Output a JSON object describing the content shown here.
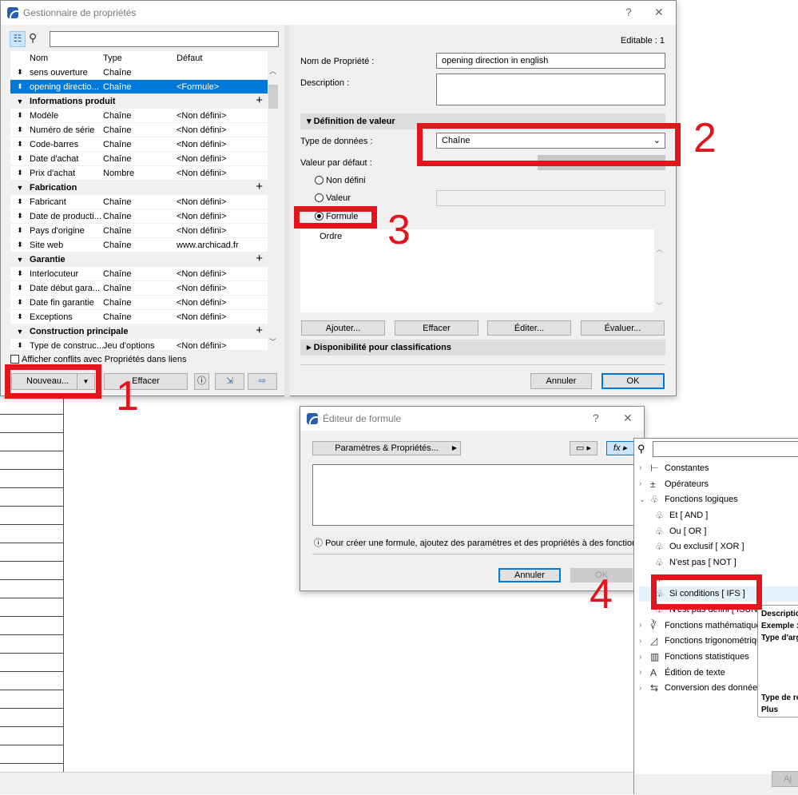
{
  "main_dialog": {
    "title": "Gestionnaire de propriétés",
    "help": "?",
    "close": "✕",
    "columns": [
      "Nom",
      "Type",
      "Défaut"
    ],
    "rows": [
      {
        "kind": "item",
        "name": "sens ouverture",
        "type": "Chaîne",
        "default": ""
      },
      {
        "kind": "item",
        "name": "opening directio...",
        "type": "Chaîne",
        "default": "<Formule>",
        "selected": true
      },
      {
        "kind": "group",
        "name": "Informations produit"
      },
      {
        "kind": "item",
        "name": "Modèle",
        "type": "Chaîne",
        "default": "<Non défini>"
      },
      {
        "kind": "item",
        "name": "Numéro de série",
        "type": "Chaîne",
        "default": "<Non défini>"
      },
      {
        "kind": "item",
        "name": "Code-barres",
        "type": "Chaîne",
        "default": "<Non défini>"
      },
      {
        "kind": "item",
        "name": "Date d'achat",
        "type": "Chaîne",
        "default": "<Non défini>"
      },
      {
        "kind": "item",
        "name": "Prix d'achat",
        "type": "Nombre",
        "default": "<Non défini>"
      },
      {
        "kind": "group",
        "name": "Fabrication"
      },
      {
        "kind": "item",
        "name": "Fabricant",
        "type": "Chaîne",
        "default": "<Non défini>"
      },
      {
        "kind": "item",
        "name": "Date de producti...",
        "type": "Chaîne",
        "default": "<Non défini>"
      },
      {
        "kind": "item",
        "name": "Pays d'origine",
        "type": "Chaîne",
        "default": "<Non défini>"
      },
      {
        "kind": "item",
        "name": "Site web",
        "type": "Chaîne",
        "default": "www.archicad.fr"
      },
      {
        "kind": "group",
        "name": "Garantie"
      },
      {
        "kind": "item",
        "name": "Interlocuteur",
        "type": "Chaîne",
        "default": "<Non défini>"
      },
      {
        "kind": "item",
        "name": "Date début gara...",
        "type": "Chaîne",
        "default": "<Non défini>"
      },
      {
        "kind": "item",
        "name": "Date fin garantie",
        "type": "Chaîne",
        "default": "<Non défini>"
      },
      {
        "kind": "item",
        "name": "Exceptions",
        "type": "Chaîne",
        "default": "<Non défini>"
      },
      {
        "kind": "group",
        "name": "Construction principale"
      },
      {
        "kind": "item",
        "name": "Type de construc...",
        "type": "Jeu d'options",
        "default": "<Non défini>"
      }
    ],
    "show_conflicts": "Afficher conflits avec Propriétés dans liens",
    "new_button": "Nouveau...",
    "delete_button": "Effacer",
    "editable": "Editable : 1",
    "name_label": "Nom de Propriété :",
    "name_value": "opening direction in english",
    "description_label": "Description :",
    "value_def_section": "Définition de valeur",
    "data_type_label": "Type de données :",
    "data_type_value": "Chaîne",
    "default_value_label": "Valeur par défaut :",
    "radio_undefined": "Non défini",
    "radio_value": "Valeur",
    "radio_formula": "Formule",
    "order_header": "Ordre",
    "add_button": "Ajouter...",
    "erase_button": "Effacer",
    "edit_button": "Éditer...",
    "evaluate_button": "Évaluer...",
    "classification_section": "Disponibilité pour classifications",
    "cancel_button": "Annuler",
    "ok_button": "OK"
  },
  "formula_editor": {
    "title": "Éditeur de formule",
    "help": "?",
    "close": "✕",
    "params_button": "Paramètres & Propriétés...",
    "hint": "Pour créer une formule, ajoutez des paramètres et des propriétés à des fonctions.",
    "cancel_button": "Annuler",
    "ok_button": "OK"
  },
  "function_panel": {
    "categories": [
      "Constantes",
      "Opérateurs",
      "Fonctions logiques"
    ],
    "logic_children": [
      "Et [ AND ]",
      "Ou [ OR ]",
      "Ou exclusif [ XOR ]",
      "N'est pas [ NOT ]",
      "",
      "Si conditions [ IFS ]",
      "N'est pas défini [ ISUND"
    ],
    "more_categories": [
      "Fonctions mathématiques",
      "Fonctions trigonométriques",
      "Fonctions statistiques",
      "Édition de texte",
      "Conversion des données"
    ],
    "tooltip": [
      "Descriptio",
      "Exemple :",
      "Type d'arg",
      "Type de ré",
      "Plus d'info"
    ],
    "add_button": "Aj"
  },
  "annotations": [
    "1",
    "2",
    "3",
    "4"
  ],
  "colors": {
    "accent": "#0078d7",
    "annotation": "#e3141c"
  }
}
